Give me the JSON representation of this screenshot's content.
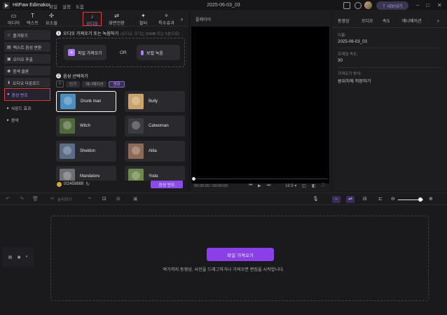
{
  "app": {
    "name": "HitPaw Edimakor",
    "menu": [
      "파일",
      "설정",
      "도움"
    ],
    "document_title": "2025-06-03_03",
    "export_label": "내보내기"
  },
  "tabs": [
    {
      "label": "미디어",
      "icon": "media-icon",
      "glyph": "▭"
    },
    {
      "label": "텍스트",
      "icon": "text-icon",
      "glyph": "T"
    },
    {
      "label": "요소들",
      "icon": "elements-icon",
      "glyph": "✣"
    },
    {
      "label": "오디오",
      "icon": "music-note-icon",
      "glyph": "♪",
      "active": true
    },
    {
      "label": "화면전환",
      "icon": "transition-icon",
      "glyph": "⇄"
    },
    {
      "label": "필터",
      "icon": "filter-sparkle-icon",
      "glyph": "✦"
    },
    {
      "label": "특수효과",
      "icon": "effects-icon",
      "glyph": "✧"
    }
  ],
  "sidebar": {
    "items": [
      {
        "label": "즐겨찾기",
        "icon": "star-icon",
        "glyph": "☆"
      },
      {
        "label": "텍스트 음성 변환",
        "icon": "tts-icon",
        "glyph": "▤"
      },
      {
        "label": "오디오 추출",
        "icon": "extract-audio-icon",
        "glyph": "▣"
      },
      {
        "label": "음색 클론",
        "icon": "voice-clone-icon",
        "glyph": "◉"
      },
      {
        "label": "오디오 다운로드",
        "icon": "download-icon",
        "glyph": "⬇"
      },
      {
        "label": "음성 변조",
        "icon": "voice-changer-icon",
        "glyph": "●",
        "active": true
      },
      {
        "label": "사운드 효과",
        "icon": "caret-right-icon",
        "glyph": "▸"
      },
      {
        "label": "음악",
        "icon": "caret-right-icon",
        "glyph": "▸"
      }
    ]
  },
  "panel": {
    "step1_label": "오디오 가져오기 또는 녹음하기",
    "step1_hint": "(오디오 크기는 50MB 또는 5분으로)",
    "import_file_label": "파일 가져오기",
    "or_label": "OR",
    "record_label": "보컬 녹음",
    "step2_label": "음성 선택하기",
    "filters": [
      "인기",
      "애니메이션",
      "영화"
    ],
    "active_filter": "영화",
    "voices": [
      {
        "name": "Drunk man",
        "selected": true,
        "color": "#4a8fbf"
      },
      {
        "name": "Bully",
        "color": "#c9a36b"
      },
      {
        "name": "Witch",
        "color": "#4f6b3a"
      },
      {
        "name": "Catwoman",
        "color": "#3b3b42"
      },
      {
        "name": "Sheldon",
        "color": "#5a6d84"
      },
      {
        "name": "Alita",
        "color": "#8e6a55"
      },
      {
        "name": "Mandalore",
        "color": "#6d6f73"
      },
      {
        "name": "Yoda",
        "color": "#6e8a4a"
      }
    ],
    "credits": "0/2459889",
    "convert_label": "음성 변조"
  },
  "player": {
    "title": "플레이어",
    "time": "00:00:00 / 00:00:00",
    "aspect": "16:9"
  },
  "properties": {
    "tabs": [
      "동영상",
      "오디오",
      "속도",
      "애니메이션"
    ],
    "fields": [
      {
        "label": "이름:",
        "value": "2025-06-03_03"
      },
      {
        "label": "프레임 속도:",
        "value": "30"
      },
      {
        "label": "가져오기 방식:",
        "value": "원위치에 저장하기"
      }
    ]
  },
  "toolbar": {
    "split_label": "분리하기"
  },
  "timeline": {
    "import_label": "파일 가져오기",
    "drop_hint": "여기까지 동영상, 사진을 드래그하거나 가져오면 편집을 시작합니다."
  },
  "colors": {
    "accent": "#8a4be8",
    "highlight_box": "#e03a3a"
  }
}
